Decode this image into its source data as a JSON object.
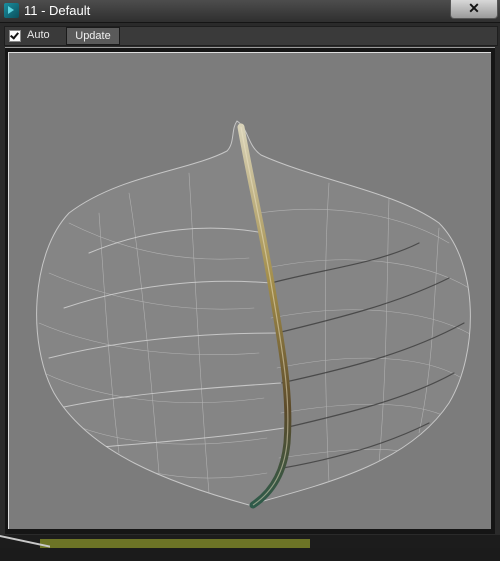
{
  "window": {
    "title": "11 - Default",
    "close_label": "✕"
  },
  "toolbar": {
    "auto_label": "Auto",
    "auto_checked": true,
    "update_label": "Update"
  },
  "viewport": {
    "content": "leaf-skeleton-material-preview",
    "background_color": "#7c7c7c"
  },
  "colors": {
    "titlebar": "#3d3d3d",
    "stem_top": "#c9a95a",
    "stem_bottom": "#3f5d3a",
    "vein": "#d8d8d8",
    "accent_strip": "#6d7426"
  }
}
